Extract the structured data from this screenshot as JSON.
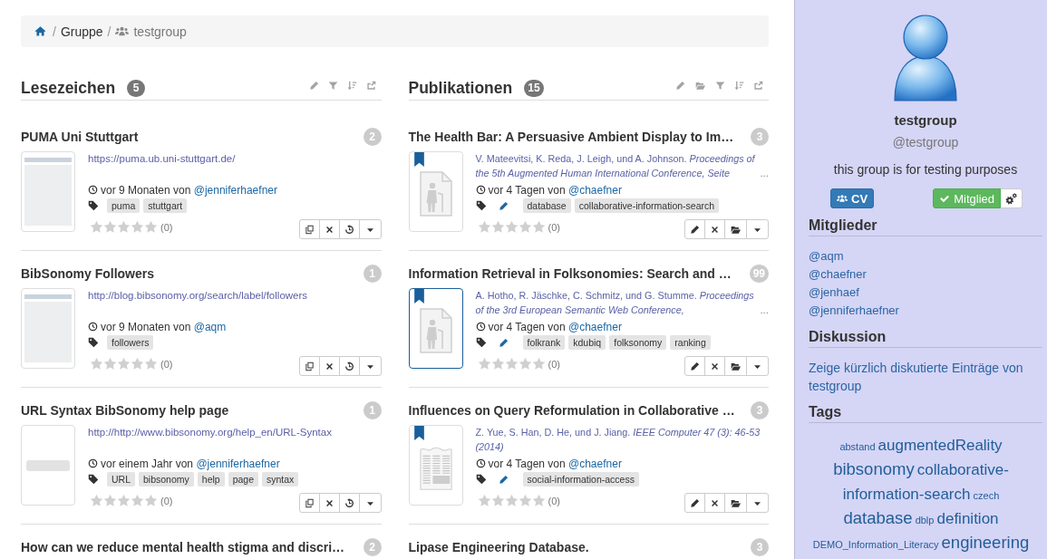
{
  "breadcrumb": [
    {
      "kind": "home"
    },
    {
      "kind": "link",
      "separator": "/",
      "label": "Gruppe"
    },
    {
      "kind": "group",
      "separator": "/",
      "label": "testgroup"
    }
  ],
  "columns": [
    {
      "title": "Lesezeichen",
      "count": "5",
      "tools": [
        {
          "kind": "edit"
        },
        {
          "kind": "filter"
        },
        {
          "kind": "sort"
        },
        {
          "kind": "export"
        }
      ],
      "item_actions": [
        {
          "kind": "copy"
        },
        {
          "kind": "delete"
        },
        {
          "kind": "history"
        },
        {
          "kind": "menu"
        }
      ],
      "items": [
        {
          "title": "PUMA Uni Stuttgart",
          "count": "2",
          "thumbnail": {
            "kind": "screenshot"
          },
          "url": "https://puma.ub.uni-stuttgart.de/",
          "meta": "vor 9 Monaten von",
          "user": "@jenniferhaefner",
          "tags": [
            "puma",
            "stuttgart"
          ],
          "stars": 0,
          "rating_count": "(0)"
        },
        {
          "title": "BibSonomy Followers",
          "count": "1",
          "thumbnail": {
            "kind": "screenshot"
          },
          "url": "http://blog.bibsonomy.org/search/label/followers",
          "meta": "vor 9 Monaten von",
          "user": "@aqm",
          "tags": [
            "followers"
          ],
          "stars": 0,
          "rating_count": "(0)"
        },
        {
          "title": "URL Syntax BibSonomy help page",
          "count": "1",
          "thumbnail": {
            "kind": "blank"
          },
          "url": "http://http://www.bibsonomy.org/help_en/URL-Syntax",
          "meta": "vor einem Jahr von",
          "user": "@jenniferhaefner",
          "tags": [
            "URL",
            "bibsonomy",
            "help",
            "page",
            "syntax"
          ],
          "stars": 0,
          "rating_count": "(0)"
        },
        {
          "title": "How can we reduce mental health stigma and discri…",
          "count": "2"
        }
      ]
    },
    {
      "title": "Publikationen",
      "count": "15",
      "editable_tags": true,
      "tools": [
        {
          "kind": "edit"
        },
        {
          "kind": "folder"
        },
        {
          "kind": "filter"
        },
        {
          "kind": "sort"
        },
        {
          "kind": "export"
        }
      ],
      "item_actions": [
        {
          "kind": "edit"
        },
        {
          "kind": "delete"
        },
        {
          "kind": "folder"
        },
        {
          "kind": "menu"
        }
      ],
      "items": [
        {
          "title": "The Health Bar: A Persuasive Ambient Display to Im…",
          "count": "3",
          "thumbnail": {
            "kind": "document"
          },
          "highlighted": false,
          "citation": "V. Mateevitsi, K. Reda, J. Leigh, und A. Johnson. *Proceedings of the 5th Augmented Human International Conference, Seite*",
          "more": "...",
          "meta": "vor 4 Tagen von",
          "user": "@chaefner",
          "tags": [
            "database",
            "collaborative-information-search"
          ],
          "stars": 0,
          "rating_count": "(0)"
        },
        {
          "title": "Information Retrieval in Folksonomies: Search and …",
          "count": "99",
          "thumbnail": {
            "kind": "document"
          },
          "highlighted": true,
          "citation": "A. Hotho, R. Jäschke, C. Schmitz, und G. Stumme. *Proceedings of the 3rd European Semantic Web Conference,*",
          "more": "...",
          "meta": "vor 4 Tagen von",
          "user": "@chaefner",
          "tags": [
            "folkrank",
            "kdubiq",
            "folksonomy",
            "ranking"
          ],
          "stars": 0,
          "rating_count": "(0)"
        },
        {
          "title": "Influences on Query Reformulation in Collaborative …",
          "count": "3",
          "thumbnail": {
            "kind": "article"
          },
          "highlighted": false,
          "citation": "Z. Yue, S. Han, D. He, und J. Jiang. *IEEE Computer 47 (3): 46-53 (2014)*",
          "meta": "vor 4 Tagen von",
          "user": "@chaefner",
          "tags": [
            "social-information-access"
          ],
          "stars": 0,
          "rating_count": "(0)"
        },
        {
          "title": "Lipase Engineering Database.",
          "count": "3"
        }
      ]
    }
  ],
  "sidebar": {
    "name": "testgroup",
    "handle": "@testgroup",
    "description": "this group is for testing purposes",
    "buttons": [
      {
        "kind": "group",
        "label": "CV"
      },
      {
        "kind": "member",
        "label": "Mitglied"
      },
      {
        "kind": "settings"
      }
    ],
    "panels": [
      {
        "title": "Mitglieder",
        "links": [
          "@aqm",
          "@chaefner",
          "@jenhaef",
          "@jenniferhaefner"
        ]
      },
      {
        "title": "Diskussion",
        "text": "Zeige kürzlich diskutierte Einträge von testgroup"
      },
      {
        "title": "Tags",
        "tags": [
          {
            "label": "abstand",
            "kind": "small"
          },
          {
            "label": "augmentedReality",
            "kind": "medium"
          },
          {
            "label": "bibsonomy",
            "kind": "large"
          },
          {
            "parts": [
              "collaborative-",
              "information-search"
            ],
            "kind": "medium"
          },
          {
            "label": "czech",
            "kind": "small"
          },
          {
            "label": "database",
            "kind": "large"
          },
          {
            "label": "dblp",
            "kind": "small"
          },
          {
            "label": "definition",
            "kind": "medium"
          },
          {
            "label": "DEMO_Information_Literacy",
            "kind": "small"
          },
          {
            "label": "engineering",
            "kind": "large"
          }
        ]
      }
    ]
  }
}
